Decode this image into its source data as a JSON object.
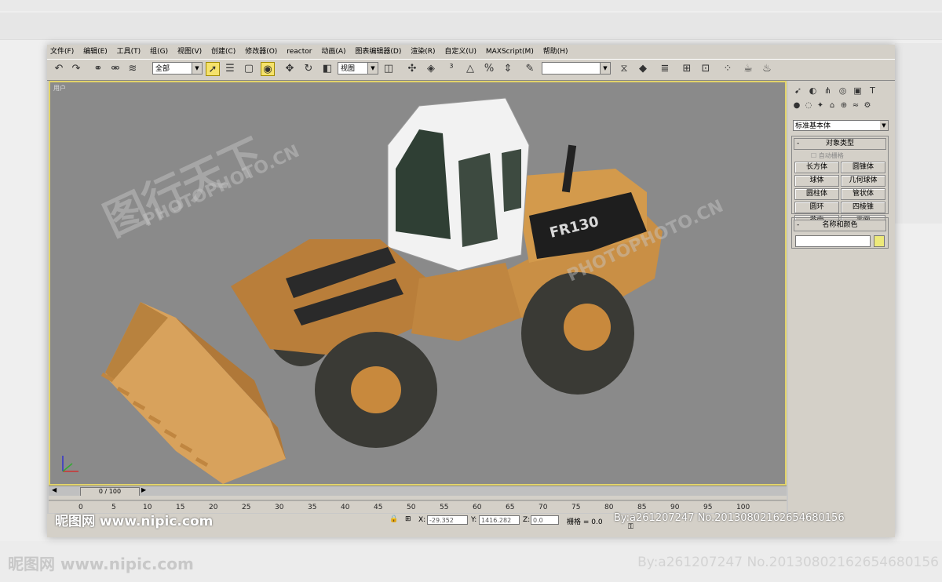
{
  "menu": [
    "文件(F)",
    "编辑(E)",
    "工具(T)",
    "组(G)",
    "视图(V)",
    "创建(C)",
    "修改器(O)",
    "reactor",
    "动画(A)",
    "图表编辑器(D)",
    "渲染(R)",
    "自定义(U)",
    "MAXScript(M)",
    "帮助(H)"
  ],
  "toolbar": {
    "selection_filter": "全部",
    "ref_coord": "视图",
    "named_sel": ""
  },
  "viewport": {
    "label": "用户",
    "watermark_cn": "图行天下",
    "watermark_en": "PHOTOPHOTO.CN",
    "model_badge": "FR130"
  },
  "command_panel": {
    "category": "标准基本体",
    "object_type_title": "对象类型",
    "autogrid": "自动栅格",
    "buttons": [
      "长方体",
      "圆锥体",
      "球体",
      "几何球体",
      "圆柱体",
      "管状体",
      "圆环",
      "四棱锥",
      "茶壶",
      "平面"
    ],
    "name_color_title": "名称和颜色"
  },
  "timeline": {
    "frame": "0 / 100",
    "ticks": [
      "0",
      "5",
      "10",
      "15",
      "20",
      "25",
      "30",
      "35",
      "40",
      "45",
      "50",
      "55",
      "60",
      "65",
      "70",
      "75",
      "80",
      "85",
      "90",
      "95",
      "100"
    ]
  },
  "status": {
    "x": "-29.352",
    "y": "1416.282",
    "z": "0.0",
    "grid_label": "栅格 = 0.0",
    "x_label": "X:",
    "y_label": "Y:",
    "z_label": "Z:"
  },
  "watermark": {
    "site": "昵图网 www.nipic.com",
    "credit": "By:a261207247 No.20130802162654680156"
  },
  "colors": {
    "viewport_bg": "#8a8a8a",
    "viewport_border": "#e2d36a",
    "ui_gray": "#d4d0c8",
    "loader_body": "#c98f45"
  }
}
